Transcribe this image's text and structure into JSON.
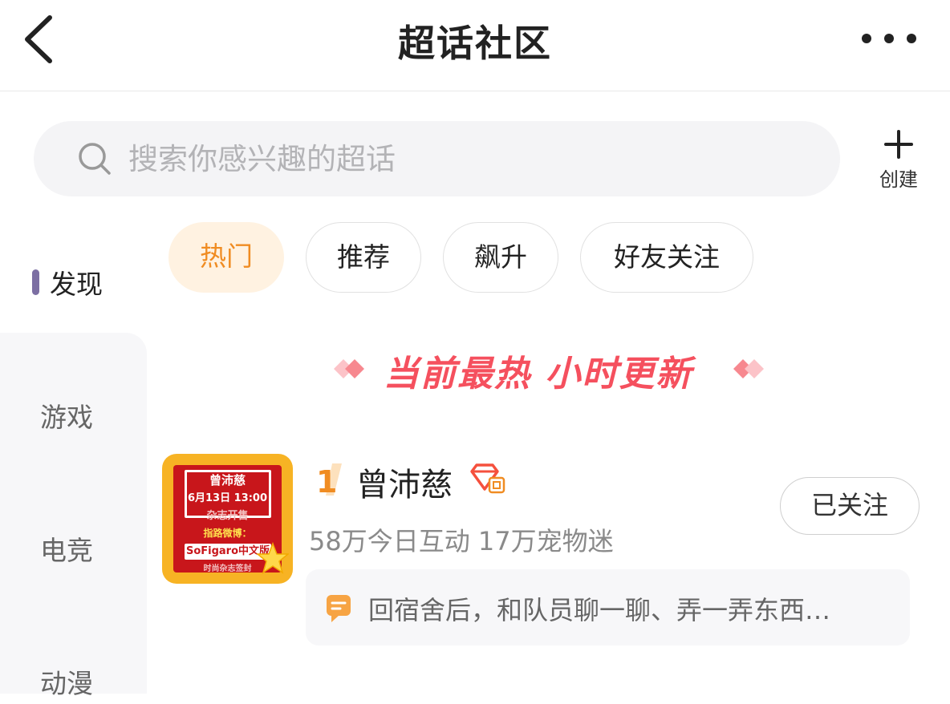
{
  "header": {
    "title": "超话社区",
    "back_icon": "chevron-left-icon",
    "more_icon": "more-horizontal-icon"
  },
  "search": {
    "placeholder": "搜索你感兴趣的超话",
    "icon": "search-icon"
  },
  "create": {
    "label": "创建",
    "icon": "plus-icon"
  },
  "side_nav": {
    "items": [
      {
        "label": "发现",
        "active": true
      },
      {
        "label": "游戏",
        "active": false
      },
      {
        "label": "电竞",
        "active": false
      },
      {
        "label": "动漫",
        "active": false
      }
    ],
    "active_color": "#7c6fa3"
  },
  "tabs": [
    {
      "label": "热门",
      "active": true
    },
    {
      "label": "推荐",
      "active": false
    },
    {
      "label": "飙升",
      "active": false
    },
    {
      "label": "好友关注",
      "active": false
    }
  ],
  "banner": {
    "text": "当前最热 小时更新",
    "color": "#f5505e"
  },
  "topics": [
    {
      "rank": "1",
      "name": "曾沛慈",
      "level_badge_icon": "diamond-level-badge-icon",
      "stats": "58万今日互动 17万宠物迷",
      "follow_label": "已关注",
      "post_preview": "回宿舍后，和队员聊一聊、弄一弄东西…",
      "post_icon": "chat-bubble-icon",
      "thumbnail": {
        "line1": "曾沛慈",
        "line2": "6月13日  13:00",
        "line3": "杂志开售",
        "line4": "指路微博：",
        "line5": "SoFigaro中文版",
        "line6": "时尚杂志签封"
      }
    }
  ],
  "colors": {
    "accent_orange": "#f08c22",
    "active_tab_bg": "#fff2e1",
    "thumb_frame": "#f7b324",
    "thumb_red": "#c8161b"
  }
}
